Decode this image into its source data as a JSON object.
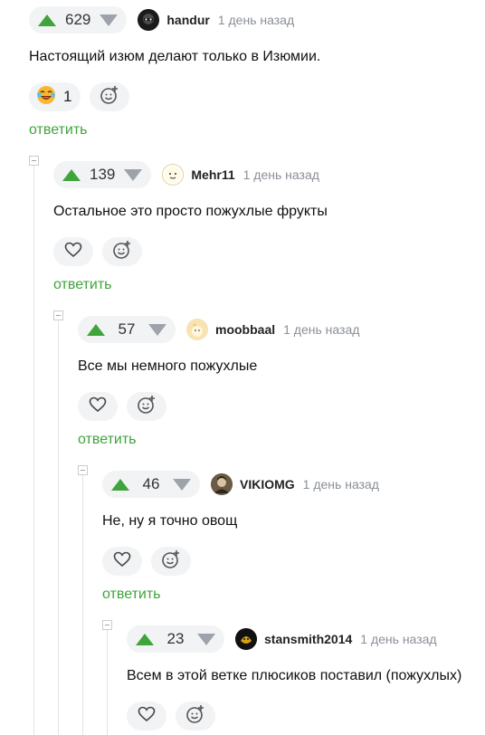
{
  "comments": [
    {
      "votes": "629",
      "username": "handur",
      "time": "1 день назад",
      "text": "Настоящий изюм делают только в Изюмии.",
      "reaction": {
        "emoji": "laughing-tears",
        "count": "1"
      },
      "reply_label": "ответить"
    },
    {
      "votes": "139",
      "username": "Mehr11",
      "time": "1 день назад",
      "text": "Остальное это просто пожухлые фрукты",
      "reply_label": "ответить"
    },
    {
      "votes": "57",
      "username": "moobbaal",
      "time": "1 день назад",
      "text": "Все мы немного пожухлые",
      "reply_label": "ответить"
    },
    {
      "votes": "46",
      "username": "VIKIOMG",
      "time": "1 день назад",
      "text": "Не, ну я точно овощ",
      "reply_label": "ответить"
    },
    {
      "votes": "23",
      "username": "stansmith2014",
      "time": "1 день назад",
      "text": "Всем в этой ветке плюсиков поставил (пожухлых)"
    }
  ],
  "colors": {
    "accent": "#3fa43a",
    "muted": "#9ea3ab",
    "pill_bg": "#f2f3f5"
  }
}
